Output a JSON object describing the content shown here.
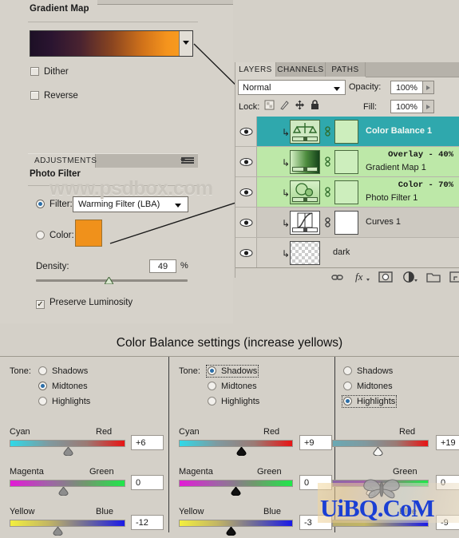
{
  "gradient_map_panel": {
    "title": "Gradient Map",
    "gradient_preview_name": "dark-purple-to-orange-gradient",
    "dropdown_icon": "chevron-down-icon",
    "dither": {
      "label": "Dither",
      "checked": false
    },
    "reverse": {
      "label": "Reverse",
      "checked": false
    }
  },
  "adjustments_panel": {
    "tab_label": "ADJUSTMENTS",
    "menu_icon": "panel-menu-icon",
    "title": "Photo Filter",
    "filter_radio": {
      "label": "Filter:",
      "selected": true
    },
    "filter_select": {
      "value": "Warming Filter (LBA)",
      "caret_icon": "chevron-down-icon"
    },
    "color_radio": {
      "label": "Color:",
      "selected": false
    },
    "color_swatch": "#f0911b",
    "density": {
      "label": "Density:",
      "value": "49",
      "unit": "%"
    },
    "preserve_luminosity": {
      "label": "Preserve Luminosity",
      "checked": true
    }
  },
  "watermark": "www.psdbox.com",
  "layers_panel": {
    "tabs": [
      {
        "label": "LAYERS",
        "active": true
      },
      {
        "label": "CHANNELS",
        "active": false
      },
      {
        "label": "PATHS",
        "active": false
      }
    ],
    "blend_mode": "Normal",
    "opacity_label": "Opacity:",
    "opacity_value": "100%",
    "lock_label": "Lock:",
    "lock_icons": [
      "lock-transparent-pixels-icon",
      "lock-image-pixels-icon",
      "lock-position-icon",
      "lock-all-icon"
    ],
    "fill_label": "Fill:",
    "fill_value": "100%",
    "layers": [
      {
        "name": "Color Balance 1",
        "note": "",
        "thumb_icon": "color-balance-scales-icon",
        "visible_icon": "eye-icon",
        "selected": true
      },
      {
        "name": "Gradient Map 1",
        "note": "Overlay - 40%",
        "thumb_icon": "gradient-map-thumb-icon",
        "visible_icon": "eye-icon",
        "selected": false
      },
      {
        "name": "Photo Filter 1",
        "note": "Color - 70%",
        "thumb_icon": "photo-filter-circles-icon",
        "visible_icon": "eye-icon",
        "selected": false
      },
      {
        "name": "Curves 1",
        "note": "",
        "thumb_icon": "curves-icon",
        "visible_icon": "eye-icon",
        "selected": false
      },
      {
        "name": "dark",
        "note": "",
        "thumb_icon": "transparent-checker-thumb",
        "visible_icon": "eye-icon",
        "selected": false
      }
    ],
    "bottom_buttons": [
      "link-layers-icon",
      "layer-style-fx-icon",
      "add-layer-mask-icon",
      "new-adjustment-layer-icon",
      "new-group-icon",
      "new-layer-icon",
      "delete-layer-icon"
    ]
  },
  "color_balance": {
    "heading": "Color Balance settings (increase yellows)",
    "tone_label": "Tone:",
    "tone_options": [
      "Shadows",
      "Midtones",
      "Highlights"
    ],
    "slider_labels": {
      "row1_left": "Cyan",
      "row1_right": "Red",
      "row2_left": "Magenta",
      "row2_right": "Green",
      "row3_left": "Yellow",
      "row3_right": "Blue"
    },
    "columns": [
      {
        "selected_tone": "Midtones",
        "values": {
          "cyan_red": "+6",
          "magenta_green": "0",
          "yellow_blue": "-12"
        },
        "thumb_positions": {
          "cyan_red": 0.52,
          "magenta_green": 0.5,
          "yellow_blue": 0.44
        },
        "thumb_style": "gray"
      },
      {
        "selected_tone": "Shadows",
        "values": {
          "cyan_red": "+9",
          "magenta_green": "0",
          "yellow_blue": "-3"
        },
        "thumb_positions": {
          "cyan_red": 0.55,
          "magenta_green": 0.5,
          "yellow_blue": 0.47
        },
        "thumb_style": "black"
      },
      {
        "selected_tone": "Highlights",
        "values": {
          "cyan_red": "+19",
          "magenta_green": "0",
          "yellow_blue": "-9"
        },
        "thumb_positions": {
          "cyan_red": 0.57,
          "magenta_green": 0.5,
          "yellow_blue": 0.46
        },
        "thumb_style": "white"
      }
    ]
  },
  "branding": {
    "logo_text": "UiBQ.CoM",
    "butterfly_icon": "butterfly-icon"
  },
  "colors": {
    "panel_bg": "#d4d0c8",
    "selected_layer": "#2fa8ad",
    "highlight_layer": "#bde8a8",
    "accent_orange": "#f0911b",
    "logo_blue": "#1b3fd4"
  }
}
